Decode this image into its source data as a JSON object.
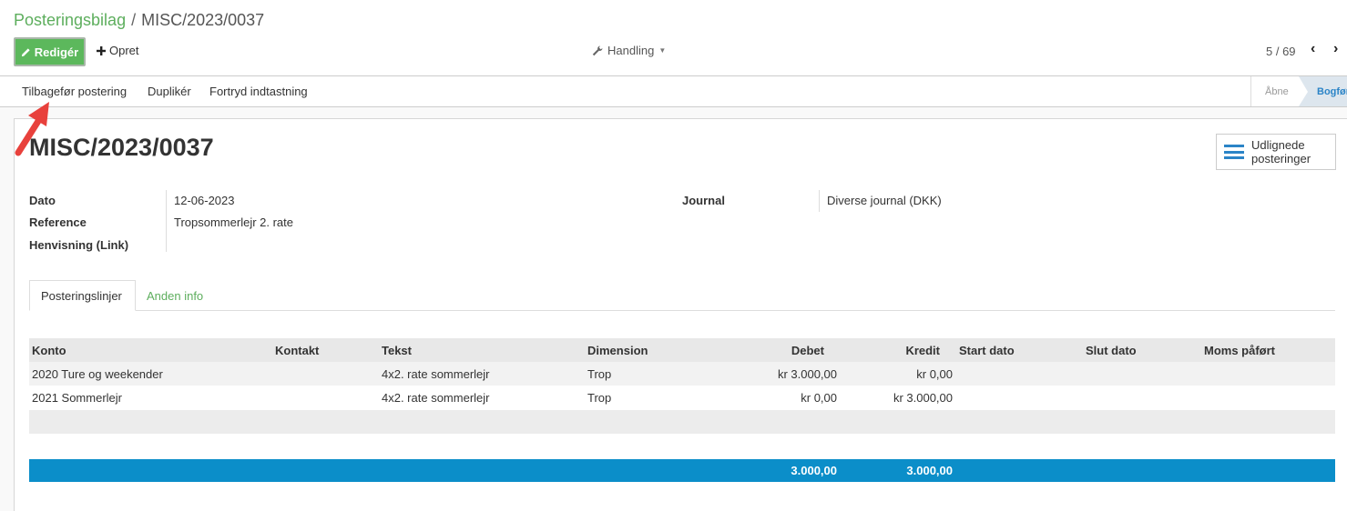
{
  "breadcrumb": {
    "parent": "Posteringsbilag",
    "separator": "/",
    "current": "MISC/2023/0037"
  },
  "toolbar": {
    "edit_label": "Redigér",
    "create_label": "Opret",
    "action_label": "Handling",
    "pager": "5 / 69"
  },
  "statusbar": {
    "buttons": [
      "Tilbagefør postering",
      "Duplikér",
      "Fortryd indtastning"
    ],
    "stages": [
      "Åbne",
      "Bogført"
    ]
  },
  "record": {
    "title": "MISC/2023/0037",
    "reconciled_button": "Udlignede posteringer"
  },
  "fields": {
    "date_label": "Dato",
    "date_value": "12-06-2023",
    "reference_label": "Reference",
    "reference_value": "Tropsommerlejr 2. rate",
    "link_label": "Henvisning (Link)",
    "journal_label": "Journal",
    "journal_value": "Diverse journal (DKK)"
  },
  "tabs": [
    "Posteringslinjer",
    "Anden info"
  ],
  "table": {
    "headers": [
      "Konto",
      "Kontakt",
      "Tekst",
      "Dimension",
      "Debet",
      "Kredit",
      "Start dato",
      "Slut dato",
      "Moms påført"
    ],
    "rows": [
      [
        "2020 Ture og weekender",
        "",
        "4x2. rate sommerlejr",
        "Trop",
        "kr 3.000,00",
        "kr 0,00"
      ],
      [
        "2021 Sommerlejr",
        "",
        "4x2. rate sommerlejr",
        "Trop",
        "kr 0,00",
        "kr 3.000,00"
      ]
    ],
    "totals": {
      "debit": "3.000,00",
      "credit": "3.000,00"
    }
  },
  "colors": {
    "accent_green": "#5cb85c",
    "accent_blue": "#0b8ec9",
    "annotation_arrow": "#e8413c"
  }
}
